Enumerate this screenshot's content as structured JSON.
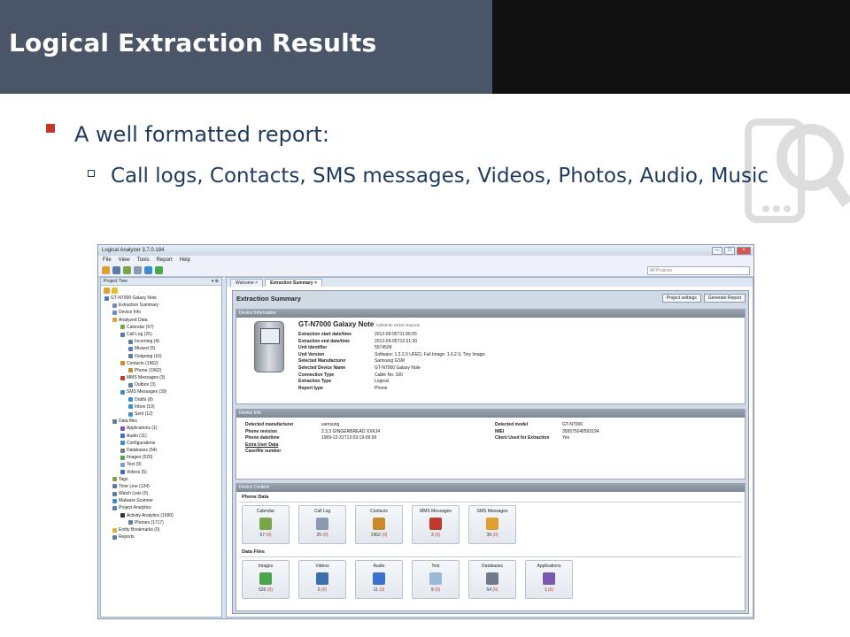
{
  "slide": {
    "title": "Logical Extraction Results",
    "bullet1": "A well formatted report:",
    "bullet2": "Call logs, Contacts, SMS messages, Videos, Photos, Audio, Music"
  },
  "app": {
    "window_title": "Logical Analyzer 3.7.0.184",
    "menu": [
      "File",
      "View",
      "Tools",
      "Report",
      "Help"
    ],
    "search_placeholder": "All Projects",
    "tree_header": "Project Tree",
    "tree_pin": "▾ ⊕",
    "tree": [
      {
        "label": "GT-N7000 Galaxy Note",
        "indent": 0,
        "color": "#4a7bbf"
      },
      {
        "label": "Extraction Summary",
        "indent": 1,
        "color": "#6b8fc4"
      },
      {
        "label": "Device Info",
        "indent": 1,
        "color": "#6b8fc4"
      },
      {
        "label": "Analyzed Data",
        "indent": 1,
        "color": "#e0a030"
      },
      {
        "label": "Calendar (67)",
        "indent": 2,
        "color": "#7aa64a"
      },
      {
        "label": "Call Log (25)",
        "indent": 2,
        "color": "#5a7ca8"
      },
      {
        "label": "Incoming (4)",
        "indent": 3,
        "color": "#5a7ca8"
      },
      {
        "label": "Missed (5)",
        "indent": 3,
        "color": "#5a7ca8"
      },
      {
        "label": "Outgoing (16)",
        "indent": 3,
        "color": "#5a7ca8"
      },
      {
        "label": "Contacts (1962)",
        "indent": 2,
        "color": "#c98a2a"
      },
      {
        "label": "Phone (1962)",
        "indent": 3,
        "color": "#c98a2a"
      },
      {
        "label": "MMS Messages (3)",
        "indent": 2,
        "color": "#c0392b"
      },
      {
        "label": "Outbox (3)",
        "indent": 3,
        "color": "#5a7ca8"
      },
      {
        "label": "SMS Messages (39)",
        "indent": 2,
        "color": "#3b8fd0"
      },
      {
        "label": "Drafts (8)",
        "indent": 3,
        "color": "#3b8fd0"
      },
      {
        "label": "Inbox (19)",
        "indent": 3,
        "color": "#3b8fd0"
      },
      {
        "label": "Sent (12)",
        "indent": 3,
        "color": "#3b8fd0"
      },
      {
        "label": "Data files",
        "indent": 1,
        "color": "#5a7ca8"
      },
      {
        "label": "Applications (1)",
        "indent": 2,
        "color": "#7a5ab0"
      },
      {
        "label": "Audio (11)",
        "indent": 2,
        "color": "#3b6fd0"
      },
      {
        "label": "Configurations",
        "indent": 2,
        "color": "#3b8fd0"
      },
      {
        "label": "Databases (54)",
        "indent": 2,
        "color": "#707a88"
      },
      {
        "label": "Images (520)",
        "indent": 2,
        "color": "#4aa64a"
      },
      {
        "label": "Text (9)",
        "indent": 2,
        "color": "#7ba0c8"
      },
      {
        "label": "Videos (5)",
        "indent": 2,
        "color": "#3b6fb0"
      },
      {
        "label": "Tags",
        "indent": 1,
        "color": "#7aa64a"
      },
      {
        "label": "Time Line (134)",
        "indent": 1,
        "color": "#5a7ca8"
      },
      {
        "label": "Watch Lists (0)",
        "indent": 1,
        "color": "#5a7ca8"
      },
      {
        "label": "Malware Scanner",
        "indent": 1,
        "color": "#3b8fd0"
      },
      {
        "label": "Project Analytics",
        "indent": 1,
        "color": "#5a7ca8"
      },
      {
        "label": "Activity Analytics (1990)",
        "indent": 2,
        "color": "#333"
      },
      {
        "label": "Phones (1717)",
        "indent": 3,
        "color": "#5a7ca8"
      },
      {
        "label": "Entity Bookmarks (0)",
        "indent": 1,
        "color": "#e0b030"
      },
      {
        "label": "Reports",
        "indent": 1,
        "color": "#5a7ca8"
      }
    ],
    "tabs": [
      "Welcome ×",
      "Extraction Summary ×"
    ],
    "summary_title": "Extraction Summary",
    "btn_settings": "Project settings",
    "btn_report": "Generate Report",
    "sec_device_information": "Device Information",
    "device_name": "GT-N7000 Galaxy Note",
    "device_source": "Cellebrite UFED Reports",
    "device_kv": [
      {
        "k": "Extraction start date/time",
        "v": "2012-09-05T11:56:55"
      },
      {
        "k": "Extraction end date/time",
        "v": "2012-09-05T12:21:30"
      },
      {
        "k": "Unit Identifier",
        "v": "5574509"
      },
      {
        "k": "Unit Version",
        "v": "Software: 1.2.2.0 UFED, Full Image: 1.0.2.9, Tiny Image:"
      },
      {
        "k": "Selected Manufacturer",
        "v": "Samsung GSM"
      },
      {
        "k": "Selected Device Name",
        "v": "GT-N7000 Galaxy Note"
      },
      {
        "k": "Connection Type",
        "v": "Cable No. 100"
      },
      {
        "k": "Extraction Type",
        "v": "Logical"
      },
      {
        "k": "Report type",
        "v": "Phone"
      }
    ],
    "sec_device_info": "Device Info",
    "info_left": [
      {
        "k": "Detected manufacturer",
        "v": "samsung"
      },
      {
        "k": "Phone revision",
        "v": "2.3.3 GINGERBREAD XXKJ4"
      },
      {
        "k": "Phone date/time",
        "v": "1999-12-31T13:03:19-09:00"
      },
      {
        "k": "Extra User Data",
        "v": ""
      },
      {
        "k": "Case/file number",
        "v": ""
      }
    ],
    "info_right": [
      {
        "k": "Detected model",
        "v": "GT-N7000"
      },
      {
        "k": "IMEI",
        "v": "359575040593194"
      },
      {
        "k": "Client Used for Extraction",
        "v": "Yes"
      }
    ],
    "sec_device_content": "Device Content",
    "phone_data_label": "Phone Data",
    "phone_tiles": [
      {
        "title": "Calendar",
        "count": "67",
        "extra": "(0)",
        "color": "#7aa64a"
      },
      {
        "title": "Call Log",
        "count": "25",
        "extra": "(0)",
        "color": "#8a9bb0"
      },
      {
        "title": "Contacts",
        "count": "1962",
        "extra": "(0)",
        "color": "#c98a2a"
      },
      {
        "title": "MMS Messages",
        "count": "3",
        "extra": "(0)",
        "color": "#c0392b"
      },
      {
        "title": "SMS Messages",
        "count": "39",
        "extra": "(0)",
        "color": "#e0a030"
      }
    ],
    "data_files_label": "Data Files",
    "file_tiles": [
      {
        "title": "Images",
        "count": "520",
        "extra": "(0)",
        "color": "#4aa64a"
      },
      {
        "title": "Videos",
        "count": "5",
        "extra": "(0)",
        "color": "#3b6fb0"
      },
      {
        "title": "Audio",
        "count": "11",
        "extra": "(0)",
        "color": "#3b6fd0"
      },
      {
        "title": "Text",
        "count": "9",
        "extra": "(0)",
        "color": "#9ab8d8"
      },
      {
        "title": "Databases",
        "count": "54",
        "extra": "(0)",
        "color": "#707a88"
      },
      {
        "title": "Applications",
        "count": "1",
        "extra": "(0)",
        "color": "#7a5ab0"
      }
    ]
  }
}
